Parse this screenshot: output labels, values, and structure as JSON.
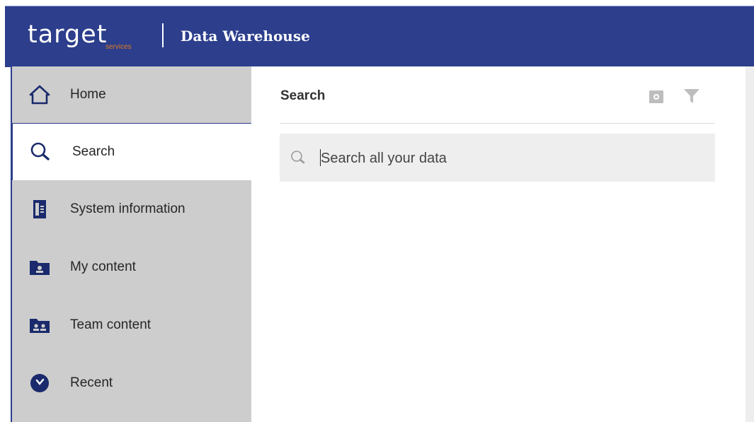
{
  "header": {
    "logo_text": "target",
    "logo_sub": "services",
    "title": "Data Warehouse",
    "colors": {
      "header_bg": "#2c3e8c",
      "logo_accent": "#e07b1f"
    }
  },
  "sidebar": {
    "items": [
      {
        "label": "Home",
        "icon": "home-icon",
        "active": false
      },
      {
        "label": "Search",
        "icon": "search-icon",
        "active": true
      },
      {
        "label": "System information",
        "icon": "system-info-icon",
        "active": false
      },
      {
        "label": "My content",
        "icon": "my-content-folder-icon",
        "active": false
      },
      {
        "label": "Team content",
        "icon": "team-content-folder-icon",
        "active": false
      },
      {
        "label": "Recent",
        "icon": "recent-clock-icon",
        "active": false
      }
    ]
  },
  "main": {
    "title": "Search",
    "toolbar_icons": [
      "saved-search-icon",
      "filter-icon"
    ],
    "search": {
      "placeholder": "Search all your data",
      "value": ""
    }
  }
}
